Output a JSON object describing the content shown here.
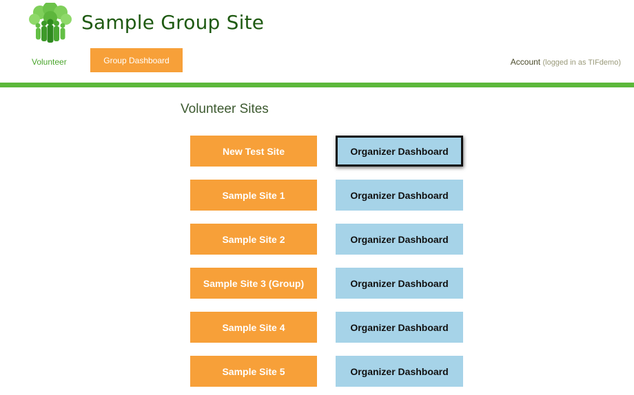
{
  "header": {
    "site_title": "Sample Group Site",
    "logo_icon": "tree-people-logo"
  },
  "nav": {
    "volunteer_label": "Volunteer",
    "group_dashboard_label": "Group Dashboard",
    "account_label": "Account",
    "account_status": "(logged in as TIFdemo)"
  },
  "main": {
    "section_title": "Volunteer Sites",
    "sites": [
      {
        "name": "New Test Site",
        "organizer_label": "Organizer Dashboard"
      },
      {
        "name": "Sample Site 1",
        "organizer_label": "Organizer Dashboard"
      },
      {
        "name": "Sample Site 2",
        "organizer_label": "Organizer Dashboard"
      },
      {
        "name": "Sample Site 3 (Group)",
        "organizer_label": "Organizer Dashboard"
      },
      {
        "name": "Sample Site 4",
        "organizer_label": "Organizer Dashboard"
      },
      {
        "name": "Sample Site 5",
        "organizer_label": "Organizer Dashboard"
      }
    ]
  },
  "colors": {
    "accent_orange": "#f7a039",
    "organizer_blue": "#a6d3e8",
    "brand_green": "#5cb83a",
    "title_green": "#1f5a12"
  }
}
